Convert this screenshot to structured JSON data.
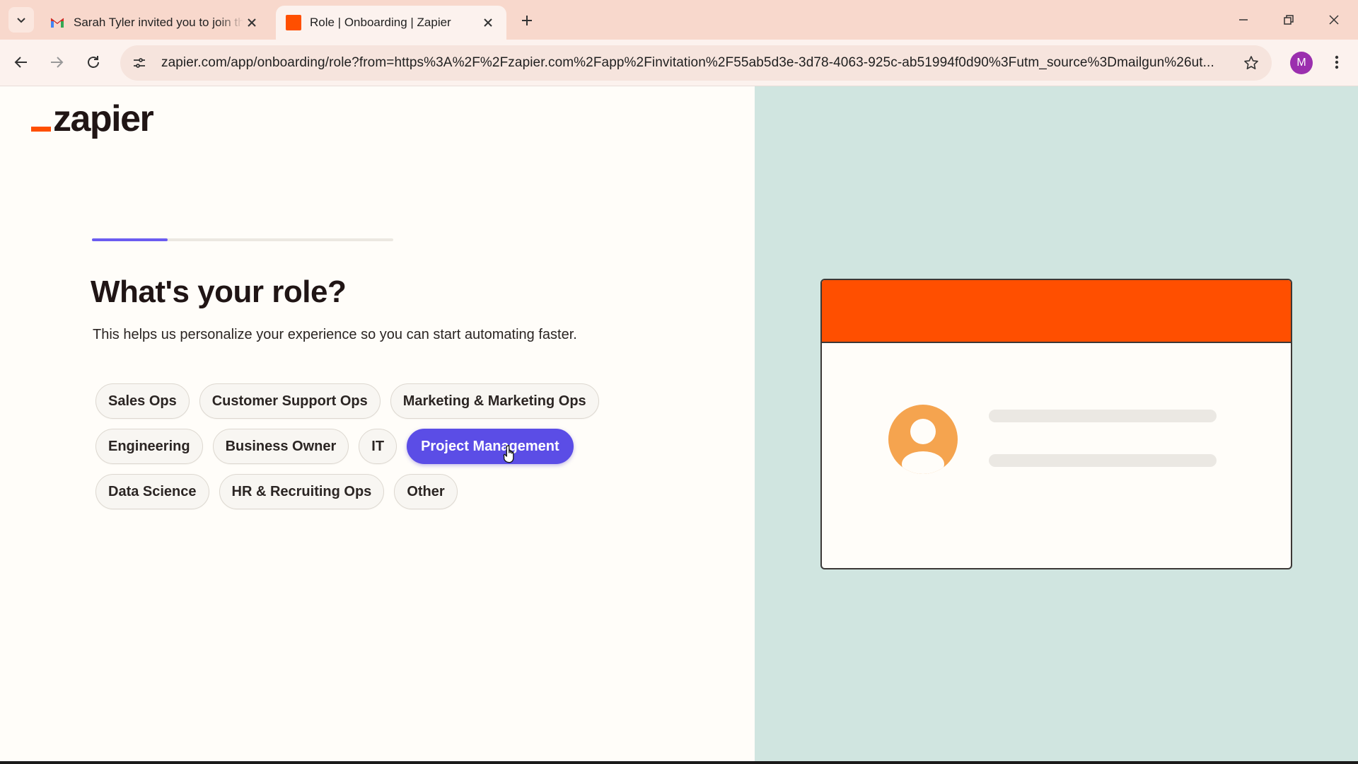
{
  "browser": {
    "tabs": [
      {
        "title": "Sarah Tyler invited you to join the",
        "favicon": "gmail-icon",
        "active": false
      },
      {
        "title": "Role | Onboarding | Zapier",
        "favicon": "zapier-favicon",
        "active": true
      }
    ],
    "url": "zapier.com/app/onboarding/role?from=https%3A%2F%2Fzapier.com%2Fapp%2Finvitation%2F55ab5d3e-3d78-4063-925c-ab51994f0d90%3Futm_source%3Dmailgun%26ut...",
    "profile_initial": "M"
  },
  "page": {
    "logo_text": "zapier",
    "progress_fraction": 0.25,
    "heading": "What's your role?",
    "subtext": "This helps us personalize your experience so you can start automating faster.",
    "role_rows": [
      [
        {
          "label": "Sales Ops",
          "selected": false
        },
        {
          "label": "Customer Support Ops",
          "selected": false
        },
        {
          "label": "Marketing & Marketing Ops",
          "selected": false
        }
      ],
      [
        {
          "label": "Engineering",
          "selected": false
        },
        {
          "label": "Business Owner",
          "selected": false
        },
        {
          "label": "IT",
          "selected": false
        },
        {
          "label": "Project Management",
          "selected": true
        }
      ],
      [
        {
          "label": "Data Science",
          "selected": false
        },
        {
          "label": "HR & Recruiting Ops",
          "selected": false
        },
        {
          "label": "Other",
          "selected": false
        }
      ]
    ]
  },
  "colors": {
    "brand_orange": "#ff4f00",
    "selected_chip": "#5b4de6",
    "right_panel": "#d0e5e0",
    "avatar": "#f5a44f"
  }
}
